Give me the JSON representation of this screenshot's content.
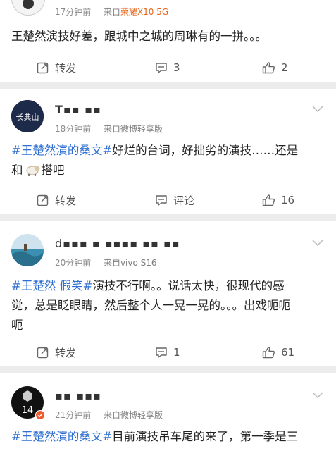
{
  "posts": [
    {
      "time": "17分钟前",
      "source_prefix": "来自",
      "source": "荣耀X10 5G",
      "text": "王楚然演技好差，跟城中之城的周琳有的一拼。。。",
      "repost_label": "转发",
      "comment_count": "3",
      "like_count": "2"
    },
    {
      "username": "T▪▪ ▪▪",
      "avatar_text": "长典山",
      "time": "18分钟前",
      "source": "来自微博轻享版",
      "hashtag": "#王楚然演的桑文#",
      "text": "好烂的台词，好拙劣的演技……还是",
      "text2_pre": "和",
      "text2_post": "搭吧",
      "repost_label": "转发",
      "comment_label": "评论",
      "like_count": "16"
    },
    {
      "username": "d▪▪▪ ▪ ▪▪▪▪ ▪▪ ▪▪",
      "time": "20分钟前",
      "source": "来自vivo S16",
      "hashtag1": "#王楚然",
      "hashtag2": "假笑#",
      "text": "演技不行啊。。说话太快，很现代的感",
      "text2": "觉，总是眨眼睛，然后整个人一晃一晃的。。。出戏呃呃",
      "text3": "呃",
      "repost_label": "转发",
      "comment_count": "1",
      "like_count": "61"
    },
    {
      "username": "▪▪ ▪▪▪",
      "avatar_number": "14",
      "time": "21分钟前",
      "source": "来自微博轻享版",
      "hashtag": "#王楚然演的桑文#",
      "text": "目前演技吊车尾的来了，第一季是三"
    }
  ],
  "colors": {
    "hashtag": "#2e6fd1",
    "brand_source": "#e8651b",
    "background": "#ececec"
  },
  "icons": [
    "repost-icon",
    "comment-icon",
    "like-icon",
    "chevron-down-icon"
  ]
}
